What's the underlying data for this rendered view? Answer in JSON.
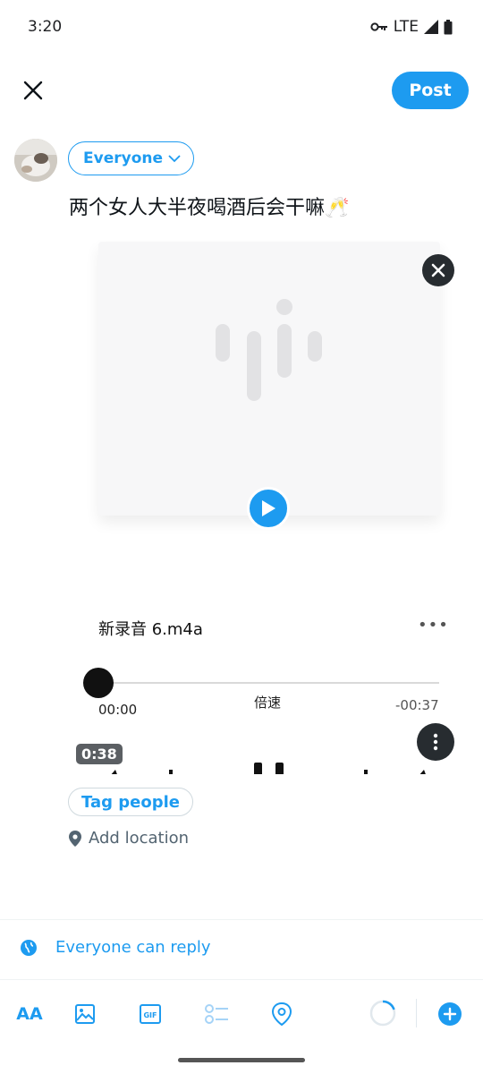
{
  "status_bar": {
    "time": "3:20",
    "network": "LTE"
  },
  "header": {
    "post_label": "Post"
  },
  "composer": {
    "audience_label": "Everyone",
    "tweet_text": "两个女人大半夜喝酒后会干嘛🥂"
  },
  "attachment": {
    "file_name": "新录音 6.m4a",
    "more_label": "•••",
    "elapsed": "00:00",
    "speed_label": "倍速",
    "remaining": "-00:37",
    "duration_badge": "0:38",
    "progress": 0
  },
  "tag_people_label": "Tag people",
  "add_location_label": "Add location",
  "reply_setting_label": "Everyone can reply",
  "toolbar": {
    "text_size_label": "AA",
    "gif_label": "GIF"
  },
  "colors": {
    "accent": "#1d9bf0",
    "text": "#0f1419",
    "muted": "#536471"
  }
}
